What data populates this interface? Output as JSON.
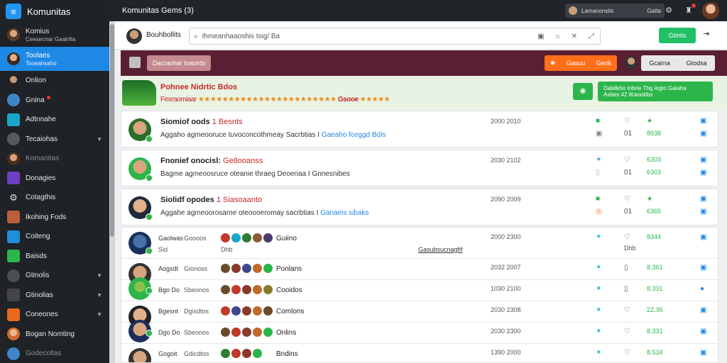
{
  "app": {
    "title": "Komunitas"
  },
  "colors": {
    "sidebar": "#1f2227",
    "accent": "#1e88e5",
    "green": "#2bb54a",
    "orange": "#ff6f1a",
    "hero": "#5a1f33",
    "red": "#c62828"
  },
  "sidebar": {
    "items": [
      {
        "label": "Komius",
        "sub": "Ceesecnar Gaalrilla"
      },
      {
        "label": "Toolaes",
        "sub": "Tooeahsaho",
        "active": true
      },
      {
        "label": "Onlion"
      },
      {
        "label": "Gnina"
      },
      {
        "label": "Adtnnahe"
      },
      {
        "label": "Tecaiohas"
      },
      {
        "label": "Komanitas"
      },
      {
        "label": "Donagies"
      },
      {
        "label": "Cotagthis"
      },
      {
        "label": "Ikohing Fods"
      },
      {
        "label": "Coiteng"
      },
      {
        "label": "Baisds"
      },
      {
        "label": "Gtinolis"
      },
      {
        "label": "Gtinolias"
      },
      {
        "label": "Coneones"
      },
      {
        "label": "Bogan Nomting"
      },
      {
        "label": "Godecoltas"
      }
    ]
  },
  "topbar": {
    "title": "Komunitas Gems (3)",
    "search_text": "Lamanonstis",
    "search_right": "Gatta"
  },
  "toolbar": {
    "name": "Bouhbollits",
    "input_value": "Ihmeanhaaoshis tsig/ Ba",
    "confirm": "Gtinlis"
  },
  "hero": {
    "btn": "Dacranhar Ioaurds",
    "orange_a": "Gasuu",
    "orange_b": "Gerik",
    "gray_a": "Gcarna",
    "gray_b": "Gtodsa"
  },
  "banner": {
    "title": "Pohnee Nidrtic Bdos",
    "stars_prefix": "Fexraomiaar",
    "stars": "★★★★★★★★★★★★★★★★★★★★★★★",
    "stars_mid": "Gsooe",
    "stars_end": "★★★★★",
    "cta_a": "Dabilkho Inbrie Thg iegto Gaiaha",
    "cta_b": "Asbes 42 IKaoobbs"
  },
  "posts": [
    {
      "title": "Siomiof oods",
      "tag": "1 Besnts",
      "desc": "Aggaho agmeooruce tuvoconcothmeay Sacrbtias I",
      "link": "Gaeaho fceggd Bdis",
      "time": "2000 2010",
      "score": "8938",
      "v2": "01"
    },
    {
      "title": "Fnonief onocisl:",
      "tag": "Ge8ooanss",
      "desc": "Bagme agmeoosruce oteanie thraeg Deoeriaa I Gnnesnibes",
      "link": "",
      "time": "2030 2102",
      "score": "6303",
      "v2": "01"
    },
    {
      "title": "Siolidf opodes",
      "tag": "1 Siasoaanto",
      "desc": "Aggahe agmeoorosarne oteoooeromay sacrbtias I",
      "link": "Ganaeis sibaks",
      "time": "2090 2009",
      "score": "6365",
      "v2": "01"
    }
  ],
  "rows": [
    {
      "name": "Gaolwas",
      "name2": "Goooos",
      "sub": "Sid",
      "sub2": "Dhb",
      "status": "Guiino",
      "time": "2000 2300",
      "score": "8344",
      "link": "Gasubsucnagfif"
    },
    {
      "name": "Aogsdt",
      "name2": "Gionoss",
      "status": "Ponlans",
      "time": "2032 2007",
      "score": "8.361"
    },
    {
      "name": "Bgo Do",
      "name2": "Sbeonos",
      "status": "Cooidos",
      "time": "1030 2100",
      "score": "8.331"
    },
    {
      "name": "Bgesnt",
      "name2": "Dgisdtos",
      "status": "Comlons",
      "time": "2030 2308",
      "score": "2Z.95"
    },
    {
      "name": "Dgo Do",
      "name2": "Sbeonos",
      "status": "Onlins",
      "time": "2030 2300",
      "score": "8.331"
    },
    {
      "name": "Gogoit",
      "name2": "Gdicdtos",
      "status": "Bndins",
      "time": "1390 2000",
      "score": "8.534"
    }
  ]
}
